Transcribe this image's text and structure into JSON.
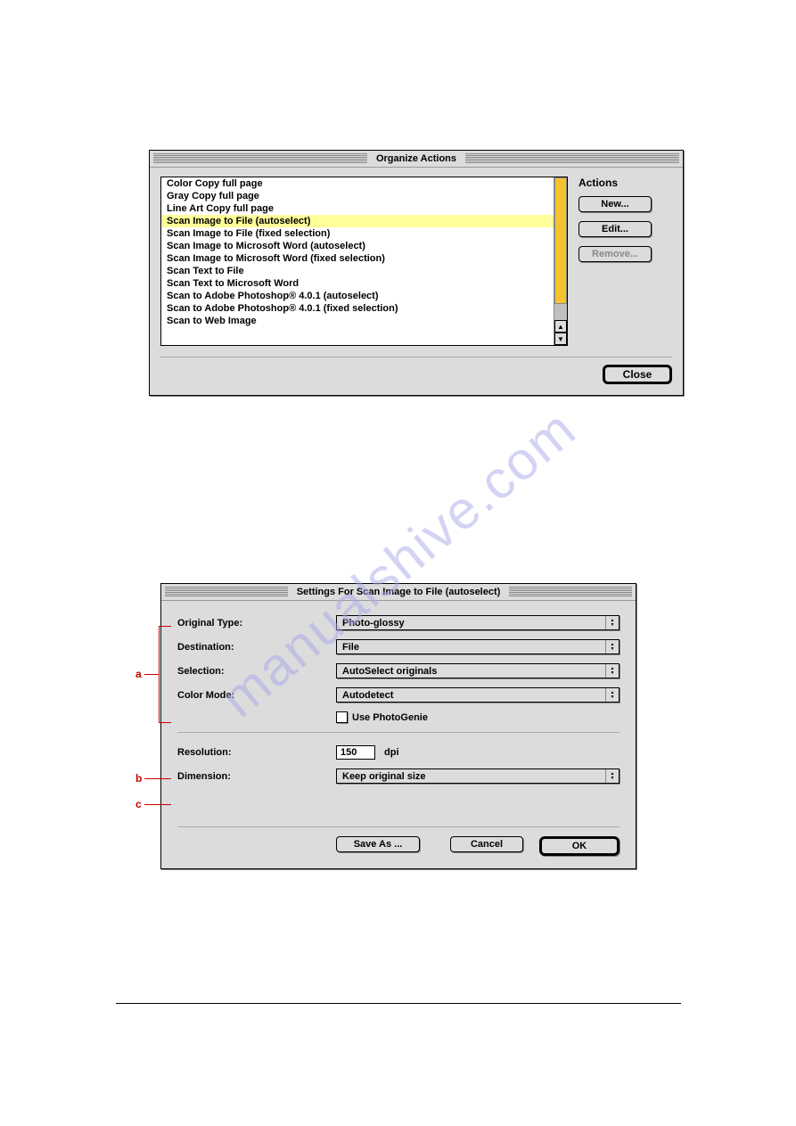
{
  "watermark": "manualshive.com",
  "dialog1": {
    "title": "Organize Actions",
    "actions_heading": "Actions",
    "new_btn": "New...",
    "edit_btn": "Edit...",
    "remove_btn": "Remove...",
    "close_btn": "Close",
    "items": [
      "Color Copy full page",
      "Gray Copy full page",
      "Line Art Copy full page",
      "Scan Image to File (autoselect)",
      "Scan Image to File (fixed selection)",
      "Scan Image to Microsoft Word (autoselect)",
      "Scan Image to Microsoft Word (fixed selection)",
      "Scan Text to File",
      "Scan Text to Microsoft Word",
      "Scan to Adobe Photoshop® 4.0.1 (autoselect)",
      "Scan to Adobe Photoshop® 4.0.1 (fixed selection)",
      "Scan to Web Image"
    ],
    "selected_index": 3
  },
  "dialog2": {
    "title": "Settings For Scan Image to File (autoselect)",
    "original_type_label": "Original Type:",
    "original_type_value": "Photo-glossy",
    "destination_label": "Destination:",
    "destination_value": "File",
    "selection_label": "Selection:",
    "selection_value": "AutoSelect originals",
    "color_mode_label": "Color Mode:",
    "color_mode_value": "Autodetect",
    "photogenie_label": "Use PhotoGenie",
    "resolution_label": "Resolution:",
    "resolution_value": "150",
    "dpi_label": "dpi",
    "dimension_label": "Dimension:",
    "dimension_value": "Keep original size",
    "saveas_btn": "Save As ...",
    "cancel_btn": "Cancel",
    "ok_btn": "OK"
  },
  "callouts": {
    "a": "a",
    "b": "b",
    "c": "c"
  }
}
